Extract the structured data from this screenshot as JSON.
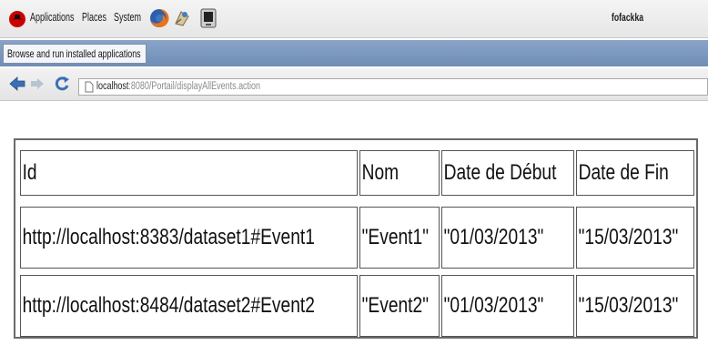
{
  "panel": {
    "menus": [
      "Applications",
      "Places",
      "System"
    ],
    "user": "fofackka"
  },
  "tooltip": {
    "text": "Browse and run installed applications"
  },
  "navigation": {
    "url_host": "localhost",
    "url_path": ":8080/Portail/displayAllEvents.action"
  },
  "table": {
    "headers": [
      "Id",
      "Nom",
      "Date de Début",
      "Date de Fin"
    ],
    "rows": [
      [
        "http://localhost:8383/dataset1#Event1",
        "\"Event1\"",
        "\"01/03/2013\"",
        "\"15/03/2013\""
      ],
      [
        "http://localhost:8484/dataset2#Event2",
        "\"Event2\"",
        "\"01/03/2013\"",
        "\"15/03/2013\""
      ]
    ]
  },
  "icons": {
    "distro_logo": "red-hat-logo-icon",
    "firefox": "firefox-icon",
    "launcher": "launcher-icon",
    "terminal": "terminal-icon",
    "back": "back-arrow-icon",
    "forward": "forward-arrow-icon",
    "reload": "reload-icon",
    "page": "page-icon"
  }
}
